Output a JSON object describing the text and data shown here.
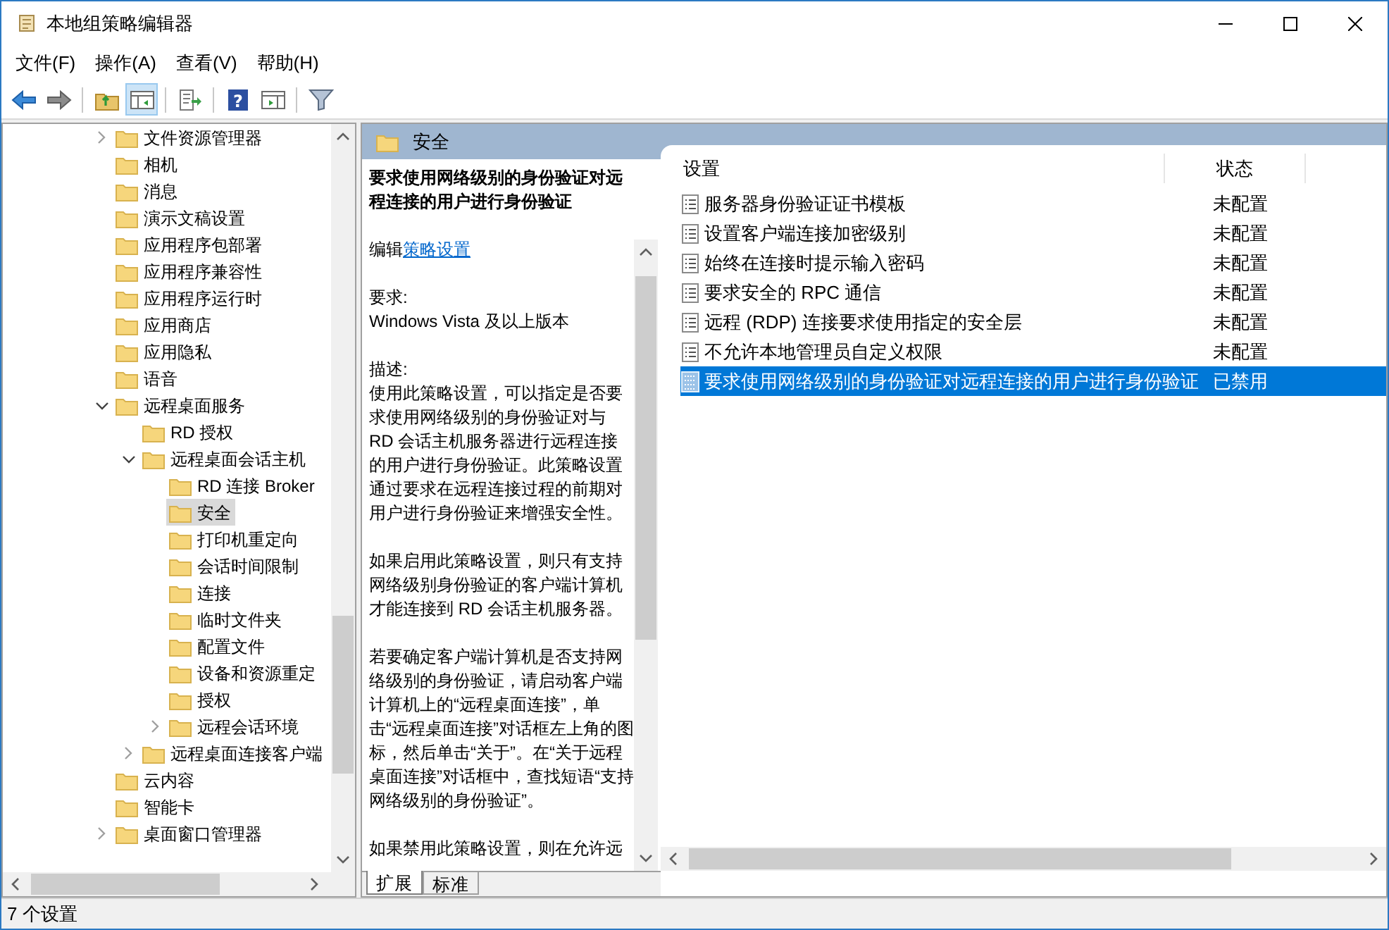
{
  "window": {
    "title": "本地组策略编辑器"
  },
  "menu": [
    "文件(F)",
    "操作(A)",
    "查看(V)",
    "帮助(H)"
  ],
  "toolbar": [
    {
      "kind": "back",
      "pressed": false
    },
    {
      "kind": "forward",
      "pressed": false
    },
    {
      "kind": "up",
      "pressed": false
    },
    {
      "kind": "tree",
      "pressed": true
    },
    {
      "kind": "export",
      "pressed": false
    },
    {
      "kind": "help",
      "pressed": false,
      "glyph": "?"
    },
    {
      "kind": "props",
      "pressed": false
    },
    {
      "kind": "filter",
      "pressed": false
    }
  ],
  "tree": [
    {
      "label": "文件资源管理器",
      "kind": "branch",
      "expanded": false,
      "selected": false
    },
    {
      "label": "相机",
      "kind": "leaf",
      "selected": false
    },
    {
      "label": "消息",
      "kind": "leaf",
      "selected": false
    },
    {
      "label": "演示文稿设置",
      "kind": "leaf",
      "selected": false
    },
    {
      "label": "应用程序包部署",
      "kind": "leaf",
      "selected": false
    },
    {
      "label": "应用程序兼容性",
      "kind": "leaf",
      "selected": false
    },
    {
      "label": "应用程序运行时",
      "kind": "leaf",
      "selected": false
    },
    {
      "label": "应用商店",
      "kind": "leaf",
      "selected": false
    },
    {
      "label": "应用隐私",
      "kind": "leaf",
      "selected": false
    },
    {
      "label": "语音",
      "kind": "leaf",
      "selected": false
    },
    {
      "label": "远程桌面服务",
      "kind": "branch",
      "expanded": true,
      "selected": false,
      "children": [
        {
          "label": "RD 授权",
          "kind": "leaf",
          "selected": false
        },
        {
          "label": "远程桌面会话主机",
          "kind": "branch",
          "expanded": true,
          "selected": false,
          "children": [
            {
              "label": "RD 连接 Broker",
              "kind": "leaf",
              "selected": false
            },
            {
              "label": "安全",
              "kind": "leaf",
              "selected": true
            },
            {
              "label": "打印机重定向",
              "kind": "leaf",
              "selected": false
            },
            {
              "label": "会话时间限制",
              "kind": "leaf",
              "selected": false
            },
            {
              "label": "连接",
              "kind": "leaf",
              "selected": false
            },
            {
              "label": "临时文件夹",
              "kind": "leaf",
              "selected": false
            },
            {
              "label": "配置文件",
              "kind": "leaf",
              "selected": false
            },
            {
              "label": "设备和资源重定",
              "kind": "leaf",
              "selected": false
            },
            {
              "label": "授权",
              "kind": "leaf",
              "selected": false
            },
            {
              "label": "远程会话环境",
              "kind": "branch",
              "expanded": false,
              "selected": false
            }
          ]
        },
        {
          "label": "远程桌面连接客户端",
          "kind": "branch",
          "expanded": false,
          "selected": false
        }
      ]
    },
    {
      "label": "云内容",
      "kind": "leaf",
      "selected": false
    },
    {
      "label": "智能卡",
      "kind": "leaf",
      "selected": false
    },
    {
      "label": "桌面窗口管理器",
      "kind": "branch",
      "expanded": false,
      "selected": false
    }
  ],
  "panel_header": {
    "title": "安全"
  },
  "description": {
    "title": "要求使用网络级别的身份验证对远程连接的用户进行身份验证",
    "edit_prefix": "编辑",
    "edit_link": "策略设置",
    "requirements_label": "要求:",
    "requirements": "Windows Vista 及以上版本",
    "description_label": "描述:",
    "paragraphs": [
      "使用此策略设置，可以指定是否要求使用网络级别的身份验证对与 RD 会话主机服务器进行远程连接的用户进行身份验证。此策略设置通过要求在远程连接过程的前期对用户进行身份验证来增强安全性。",
      "如果启用此策略设置，则只有支持网络级别身份验证的客户端计算机才能连接到 RD 会话主机服务器。",
      "若要确定客户端计算机是否支持网络级别的身份验证，请启动客户端计算机上的“远程桌面连接”，单击“远程桌面连接”对话框左上角的图标，然后单击“关于”。在“关于远程桌面连接”对话框中，查找短语“支持网络级别的身份验证”。",
      "如果禁用此策略设置，则在允许远"
    ]
  },
  "table": {
    "columns": [
      "设置",
      "状态"
    ],
    "rows": [
      {
        "setting": "服务器身份验证证书模板",
        "state": "未配置",
        "selected": false
      },
      {
        "setting": "设置客户端连接加密级别",
        "state": "未配置",
        "selected": false
      },
      {
        "setting": "始终在连接时提示输入密码",
        "state": "未配置",
        "selected": false
      },
      {
        "setting": "要求安全的 RPC 通信",
        "state": "未配置",
        "selected": false
      },
      {
        "setting": "远程 (RDP) 连接要求使用指定的安全层",
        "state": "未配置",
        "selected": false
      },
      {
        "setting": "不允许本地管理员自定义权限",
        "state": "未配置",
        "selected": false
      },
      {
        "setting": "要求使用网络级别的身份验证对远程连接的用户进行身份验证",
        "state": "已禁用",
        "selected": true
      }
    ]
  },
  "tabs": [
    {
      "label": "扩展",
      "selected": true
    },
    {
      "label": "标准",
      "selected": false
    }
  ],
  "status_bar": "7 个设置"
}
